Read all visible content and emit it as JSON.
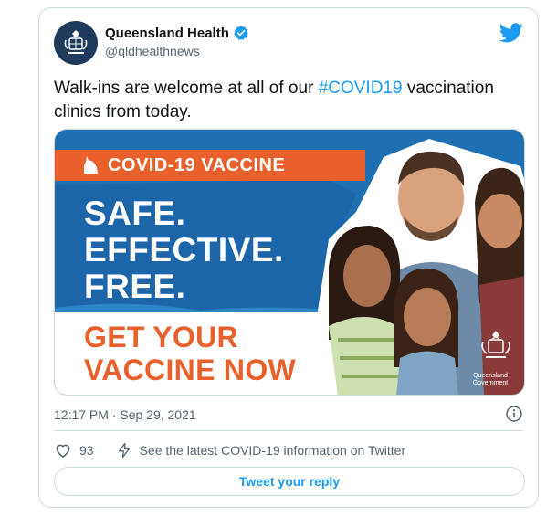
{
  "account": {
    "display_name": "Queensland Health",
    "handle": "@qldhealthnews",
    "avatar_icon": "queensland-crest-icon",
    "verified_icon": "verified-badge-icon",
    "avatar_caption": "Queensland Government"
  },
  "platform_icon": "twitter-bird-icon",
  "tweet": {
    "text_before": "Walk-ins are welcome at all of our ",
    "hashtag": "#COVID19",
    "text_after": " vaccination clinics from today."
  },
  "media": {
    "header": "COVID-19 VACCINE",
    "lines": [
      "SAFE.",
      "EFFECTIVE.",
      "FREE."
    ],
    "cta_lines": [
      "GET YOUR",
      "VACCINE NOW"
    ],
    "logo_caption_1": "Queensland",
    "logo_caption_2": "Government",
    "colors": {
      "brand_blue": "#1f6fb3",
      "brand_orange": "#e8612c"
    }
  },
  "meta": {
    "timestamp": "12:17 PM · Sep 29, 2021",
    "info_icon": "info-icon"
  },
  "actions": {
    "like_icon": "heart-icon",
    "like_count": "93",
    "flash_icon": "lightning-icon",
    "info_link": "See the latest COVID-19 information on Twitter"
  },
  "reply": {
    "label": "Tweet your reply"
  },
  "accent": "#1d9bf0"
}
